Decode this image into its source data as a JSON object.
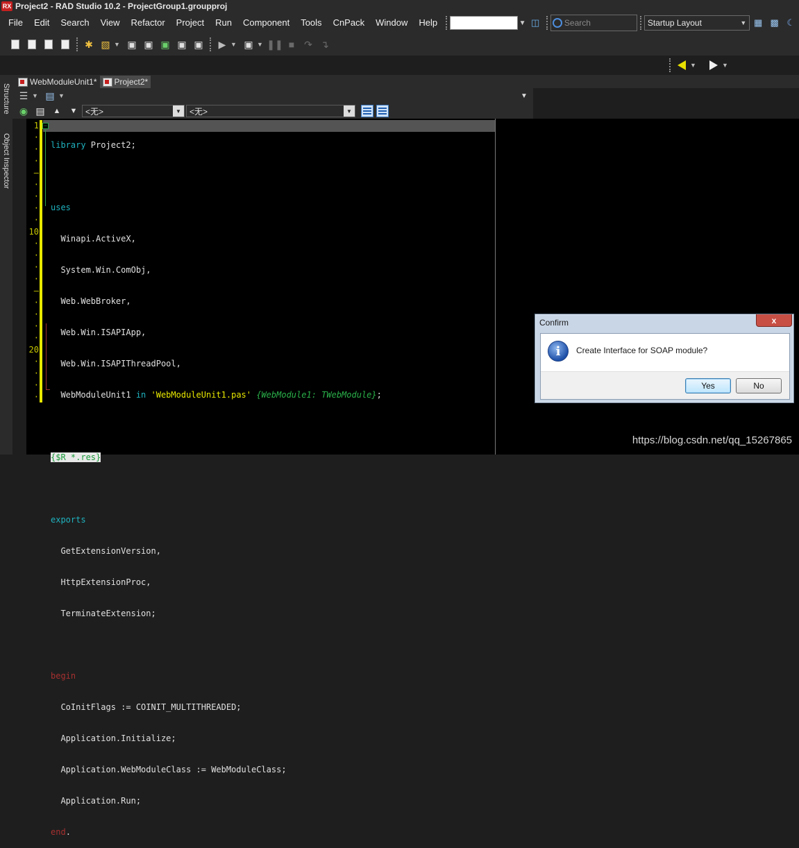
{
  "window": {
    "app_icon": "RX",
    "title": "Project2 - RAD Studio 10.2 - ProjectGroup1.groupproj"
  },
  "menu": [
    "File",
    "Edit",
    "Search",
    "View",
    "Refactor",
    "Project",
    "Run",
    "Component",
    "Tools",
    "CnPack",
    "Window",
    "Help"
  ],
  "search": {
    "placeholder": "Search"
  },
  "layout_combo": {
    "value": "Startup Layout"
  },
  "side_panels": [
    "Structure",
    "Object Inspector"
  ],
  "tabs": [
    {
      "label": "WebModuleUnit1*",
      "active": false
    },
    {
      "label": "Project2*",
      "active": true
    }
  ],
  "nav": {
    "combo1": "<无>",
    "combo2": "<无>"
  },
  "editor": {
    "line_numbers": [
      {
        "line": 1,
        "label": "1"
      },
      {
        "line": 10,
        "label": "10"
      },
      {
        "line": 20,
        "label": "20"
      }
    ],
    "code": {
      "l1_kw": "library",
      "l1_rest": " Project2;",
      "l3_kw": "uses",
      "l4": "  Winapi.ActiveX,",
      "l5": "  System.Win.ComObj,",
      "l6": "  Web.WebBroker,",
      "l7": "  Web.Win.ISAPIApp,",
      "l8": "  Web.Win.ISAPIThreadPool,",
      "l9_a": "  WebModuleUnit1 ",
      "l9_in": "in",
      "l9_str": " 'WebModuleUnit1.pas'",
      "l9_cmt": " {WebModule1: TWebModule}",
      "l9_end": ";",
      "l11": "{$R *.res}",
      "l13_kw": "exports",
      "l14": "  GetExtensionVersion,",
      "l15": "  HttpExtensionProc,",
      "l16": "  TerminateExtension;",
      "l18_kw": "begin",
      "l19": "  CoInitFlags := COINIT_MULTITHREADED;",
      "l20": "  Application.Initialize;",
      "l21": "  Application.WebModuleClass := WebModuleClass;",
      "l22": "  Application.Run;",
      "l23_kw": "end",
      "l23_rest": "."
    }
  },
  "dialog": {
    "title": "Confirm",
    "close": "x",
    "icon": "info-icon",
    "message": "Create Interface for SOAP module?",
    "yes": "Yes",
    "no": "No"
  },
  "watermark": "https://blog.csdn.net/qq_15267865"
}
